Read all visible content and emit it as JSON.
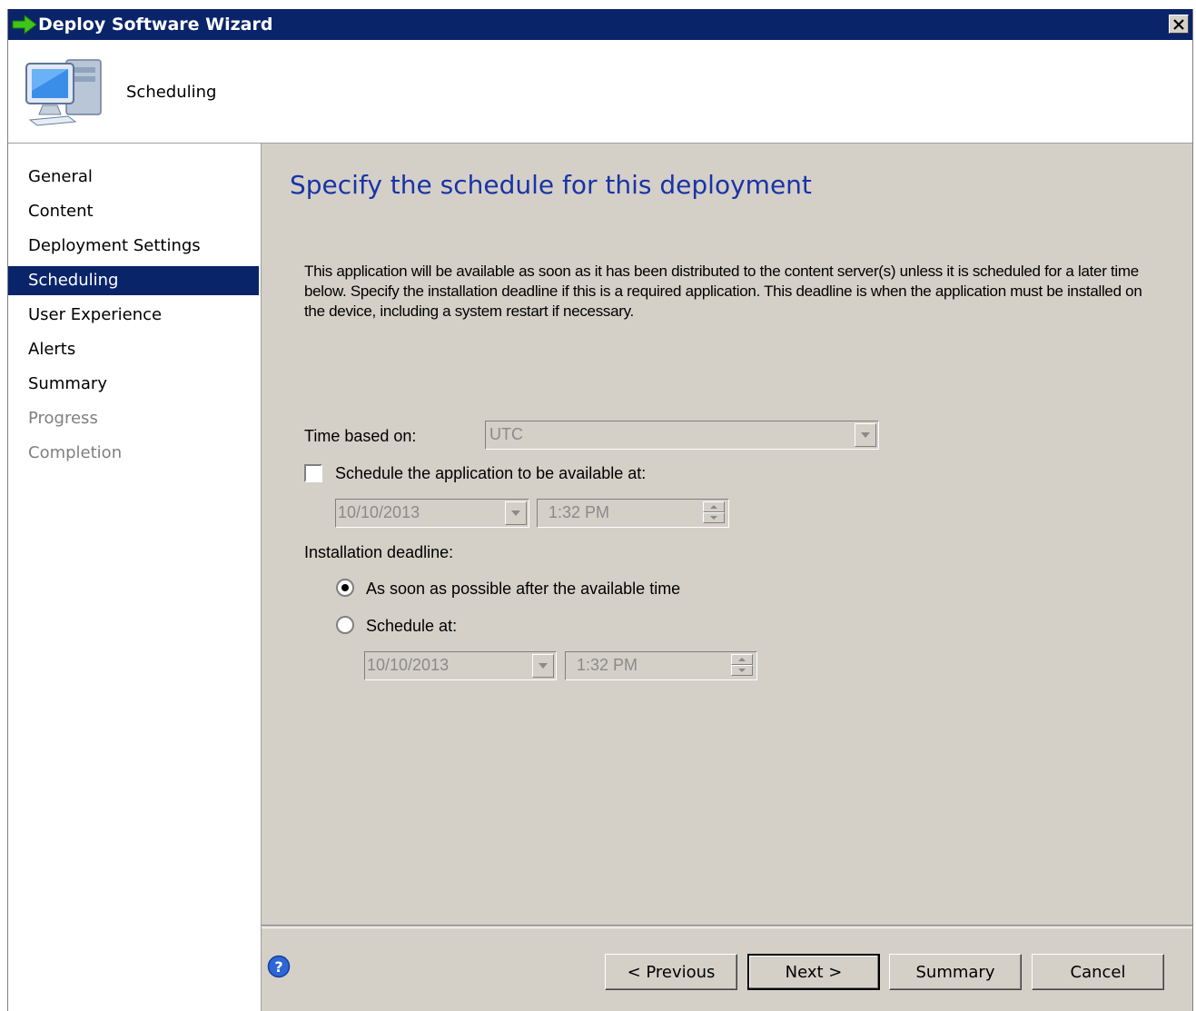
{
  "window": {
    "title": "Deploy Software Wizard"
  },
  "header": {
    "title": "Scheduling"
  },
  "nav": {
    "items": [
      {
        "label": "General",
        "state": "normal"
      },
      {
        "label": "Content",
        "state": "normal"
      },
      {
        "label": "Deployment Settings",
        "state": "normal"
      },
      {
        "label": "Scheduling",
        "state": "active"
      },
      {
        "label": "User Experience",
        "state": "normal"
      },
      {
        "label": "Alerts",
        "state": "normal"
      },
      {
        "label": "Summary",
        "state": "normal"
      },
      {
        "label": "Progress",
        "state": "disabled"
      },
      {
        "label": "Completion",
        "state": "disabled"
      }
    ]
  },
  "main": {
    "title": "Specify the schedule for this deployment",
    "description": "This application will be available as soon as it has been distributed to the content server(s) unless it is scheduled for a later time below. Specify the installation deadline if this is a required application. This deadline is when the application must be installed on the device, including a system restart if necessary.",
    "time_based_label": "Time based on:",
    "time_based_value": "UTC",
    "schedule_available_label": "Schedule the application to be available at:",
    "schedule_available_checked": false,
    "available_date": "10/10/2013",
    "available_time": "1:32 PM",
    "deadline_label": "Installation deadline:",
    "asap_label": "As soon as possible after the available time",
    "asap_checked": true,
    "schedule_at_label": "Schedule at:",
    "schedule_at_checked": false,
    "deadline_date": "10/10/2013",
    "deadline_time": "1:32 PM"
  },
  "footer": {
    "previous_label": "< Previous",
    "next_label": "Next >",
    "summary_label": "Summary",
    "cancel_label": "Cancel"
  },
  "colors": {
    "titlebar": "#0a246a",
    "selection": "#0a246a",
    "page_title": "#1a33a6",
    "face": "#d4d0c8"
  },
  "icons": {
    "title_icon": "green-arrow-icon",
    "header_icon": "computer-icon",
    "help_icon": "help-icon",
    "close_icon": "close-icon"
  }
}
